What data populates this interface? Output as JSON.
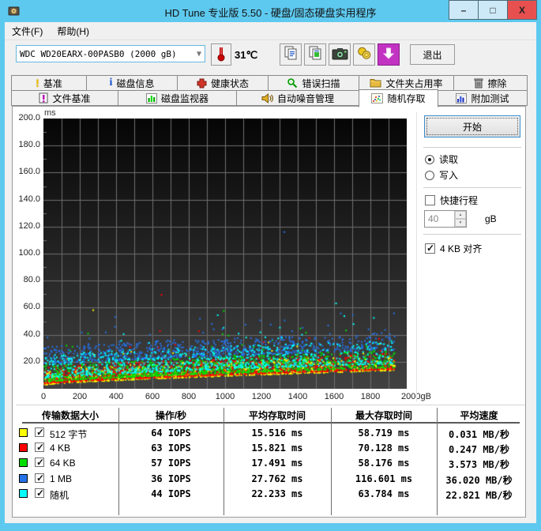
{
  "window": {
    "title": "HD Tune 专业版 5.50 - 硬盘/固态硬盘实用程序",
    "minimize": "–",
    "maximize": "□",
    "close": "X"
  },
  "menu": {
    "file": "文件(F)",
    "help": "帮助(H)"
  },
  "toolbar": {
    "drive": "WDC WD20EARX-00PASB0  (2000 gB)",
    "temperature": "31℃",
    "exit": "退出"
  },
  "tabs": {
    "row1": [
      {
        "label": "基准"
      },
      {
        "label": "磁盘信息"
      },
      {
        "label": "健康状态"
      },
      {
        "label": "错误扫描"
      },
      {
        "label": "文件夹占用率"
      },
      {
        "label": "擦除"
      }
    ],
    "row2": [
      {
        "label": "文件基准"
      },
      {
        "label": "磁盘监视器"
      },
      {
        "label": "自动噪音管理"
      },
      {
        "label": "随机存取"
      },
      {
        "label": "附加测试"
      }
    ],
    "active": "随机存取"
  },
  "controls": {
    "start": "开始",
    "read": "读取",
    "write": "写入",
    "short_stroke": "快捷行程",
    "stroke_value": "40",
    "stroke_unit": "gB",
    "align_4kb": "4 KB 对齐"
  },
  "chart_data": {
    "type": "scatter",
    "y_unit": "ms",
    "x_unit": "gB",
    "xlim": [
      0,
      2000
    ],
    "ylim": [
      0,
      200
    ],
    "x_ticks": [
      "0",
      "200",
      "400",
      "600",
      "800",
      "1000",
      "1200",
      "1400",
      "1600",
      "1800",
      "2000gB"
    ],
    "y_ticks": [
      "200.0",
      "180.0",
      "160.0",
      "140.0",
      "120.0",
      "100.0",
      "80.0",
      "60.0",
      "40.0",
      "20.0"
    ],
    "grid": {
      "x_step_gb": 100,
      "y_step_ms": 20,
      "color": "#6f6f6f"
    },
    "bg_gradient": [
      "#060606",
      "#424242"
    ],
    "series": [
      {
        "label": "512 字节",
        "color": "#ffff00",
        "iops": "64 IOPS",
        "avg": "15.516 ms",
        "max": "58.719 ms",
        "speed": "0.031 MB/秒",
        "max_ms": 58.719,
        "gen": {
          "count": 950,
          "lift": 0,
          "spread": 11,
          "pow": 2.2,
          "outRate": 0.015,
          "outHi": 22
        }
      },
      {
        "label": "4 KB",
        "color": "#ff0000",
        "iops": "63 IOPS",
        "avg": "15.821 ms",
        "max": "70.128 ms",
        "speed": "0.247 MB/秒",
        "max_ms": 70.128,
        "gen": {
          "count": 950,
          "lift": 0.8,
          "spread": 12,
          "pow": 2.2,
          "outRate": 0.015,
          "outHi": 28
        }
      },
      {
        "label": "64 KB",
        "color": "#00dd00",
        "iops": "57 IOPS",
        "avg": "17.491 ms",
        "max": "58.176 ms",
        "speed": "3.573 MB/秒",
        "max_ms": 58.176,
        "gen": {
          "count": 950,
          "lift": 2,
          "spread": 13,
          "pow": 2.0,
          "outRate": 0.03,
          "outHi": 28
        }
      },
      {
        "label": "1 MB",
        "color": "#2472e8",
        "iops": "36 IOPS",
        "avg": "27.762 ms",
        "max": "116.601 ms",
        "speed": "36.020 MB/秒",
        "max_ms": 116.601,
        "gen": {
          "count": 750,
          "lift": 15,
          "spread": 13,
          "pow": 1.8,
          "outRate": 0.05,
          "outHi": 25
        }
      },
      {
        "label": "随机",
        "color": "#00ffff",
        "iops": "44 IOPS",
        "avg": "22.233 ms",
        "max": "63.784 ms",
        "speed": "22.821 MB/秒",
        "max_ms": 63.784,
        "gen": {
          "count": 850,
          "lift": 5,
          "spread": 17,
          "pow": 1.9,
          "outRate": 0.04,
          "outHi": 28
        }
      }
    ]
  },
  "table": {
    "headers": [
      "传输数据大小",
      "操作/秒",
      "平均存取时间",
      "最大存取时间",
      "平均速度"
    ]
  }
}
